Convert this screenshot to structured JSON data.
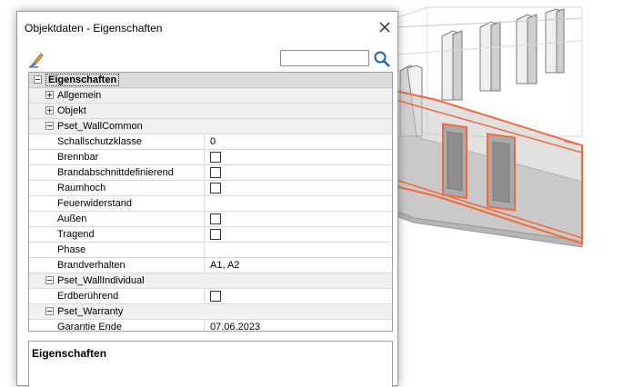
{
  "window": {
    "title": "Objektdaten - Eigenschaften",
    "close_glyph": "✕"
  },
  "toolbar": {
    "brush_icon": "brush-icon",
    "search_value": "",
    "search_icon": "search-icon"
  },
  "grid": {
    "root_label": "Eigenschaften",
    "rows": [
      {
        "kind": "cat",
        "label": "Allgemein",
        "expanded": false
      },
      {
        "kind": "cat",
        "label": "Objekt",
        "expanded": false
      },
      {
        "kind": "cat",
        "label": "Pset_WallCommon",
        "expanded": true
      },
      {
        "kind": "prop",
        "label": "Schallschutzklasse",
        "value": "0"
      },
      {
        "kind": "prop",
        "label": "Brennbar",
        "checkbox": true,
        "checked": false
      },
      {
        "kind": "prop",
        "label": "Brandabschnittdefinierend",
        "checkbox": true,
        "checked": false
      },
      {
        "kind": "prop",
        "label": "Raumhoch",
        "checkbox": true,
        "checked": false
      },
      {
        "kind": "prop",
        "label": "Feuerwiderstand",
        "value": ""
      },
      {
        "kind": "prop",
        "label": "Außen",
        "checkbox": true,
        "checked": false
      },
      {
        "kind": "prop",
        "label": "Tragend",
        "checkbox": true,
        "checked": false
      },
      {
        "kind": "prop",
        "label": "Phase",
        "value": ""
      },
      {
        "kind": "prop",
        "label": "Brandverhalten",
        "value": "A1, A2"
      },
      {
        "kind": "cat",
        "label": "Pset_WallIndividual",
        "expanded": true
      },
      {
        "kind": "prop",
        "label": "Erdberührend",
        "checkbox": true,
        "checked": false
      },
      {
        "kind": "cat",
        "label": "Pset_Warranty",
        "expanded": true
      },
      {
        "kind": "prop",
        "label": "Garantie Ende",
        "value": "07.06.2023"
      }
    ]
  },
  "description": {
    "title": "Eigenschaften"
  },
  "colors": {
    "highlight": "#f26a3c",
    "wall_gray": "#c9c9c9"
  }
}
